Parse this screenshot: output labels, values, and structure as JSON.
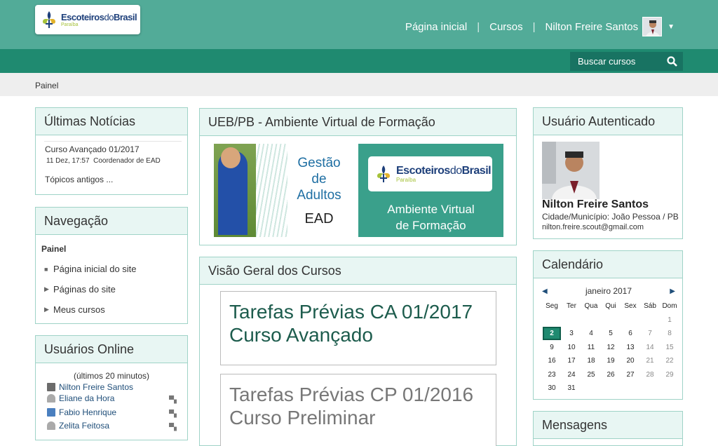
{
  "header": {
    "logo": {
      "name_part1": "Escoteiros",
      "name_part2": "do",
      "name_part3": "Brasil",
      "region": "Paraíba"
    },
    "nav": [
      {
        "label": "Página inicial"
      },
      {
        "label": "Cursos"
      }
    ],
    "user_name": "Nilton Freire Santos",
    "search_placeholder": "Buscar cursos"
  },
  "breadcrumb": {
    "label": "Painel"
  },
  "news": {
    "title": "Últimas Notícias",
    "item_title": "Curso Avançado 01/2017",
    "item_date": "11 Dez, 17:57",
    "item_author": "Coordenador de EAD",
    "older_link": "Tópicos antigos ..."
  },
  "navigation": {
    "title": "Navegação",
    "root": "Painel",
    "items": [
      {
        "label": "Página inicial do site",
        "marker": "square"
      },
      {
        "label": "Páginas do site",
        "marker": "triangle"
      },
      {
        "label": "Meus cursos",
        "marker": "triangle"
      }
    ]
  },
  "online": {
    "title": "Usuários Online",
    "caption": "(últimos 20 minutos)",
    "users": [
      {
        "name": "Nilton Freire Santos",
        "has_msg": false
      },
      {
        "name": "Eliane da Hora",
        "has_msg": true
      },
      {
        "name": "Fabio Henrique",
        "has_msg": true
      },
      {
        "name": "Zelita Feitosa",
        "has_msg": true
      }
    ]
  },
  "ueb": {
    "title": "UEB/PB - Ambiente Virtual de Formação",
    "banner_left_l1": "Gestão",
    "banner_left_l2": "de",
    "banner_left_l3": "Adultos",
    "banner_left_ead": "EAD",
    "banner_right_l1": "Ambiente Virtual",
    "banner_right_l2": "de Formação"
  },
  "overview": {
    "title": "Visão Geral dos Cursos",
    "courses": [
      {
        "line1": "Tarefas Prévias CA 01/2017",
        "line2": "Curso Avançado"
      },
      {
        "line1": "Tarefas Prévias CP 01/2016",
        "line2": "Curso Preliminar"
      }
    ]
  },
  "auth": {
    "title": "Usuário Autenticado",
    "name": "Nilton Freire Santos",
    "city": "Cidade/Município: João Pessoa / PB",
    "email": "nilton.freire.scout@gmail.com"
  },
  "calendar": {
    "title": "Calendário",
    "month": "janeiro 2017",
    "weekdays": [
      "Seg",
      "Ter",
      "Qua",
      "Qui",
      "Sex",
      "Sáb",
      "Dom"
    ],
    "weeks": [
      [
        "",
        "",
        "",
        "",
        "",
        "",
        "1"
      ],
      [
        "2",
        "3",
        "4",
        "5",
        "6",
        "7",
        "8"
      ],
      [
        "9",
        "10",
        "11",
        "12",
        "13",
        "14",
        "15"
      ],
      [
        "16",
        "17",
        "18",
        "19",
        "20",
        "21",
        "22"
      ],
      [
        "23",
        "24",
        "25",
        "26",
        "27",
        "28",
        "29"
      ],
      [
        "30",
        "31",
        "",
        "",
        "",
        "",
        ""
      ]
    ],
    "today": "2"
  },
  "messages": {
    "title": "Mensagens"
  },
  "colors": {
    "primary": "#52ab98",
    "secondary": "#1f8a70",
    "accent": "#3aa08b"
  }
}
